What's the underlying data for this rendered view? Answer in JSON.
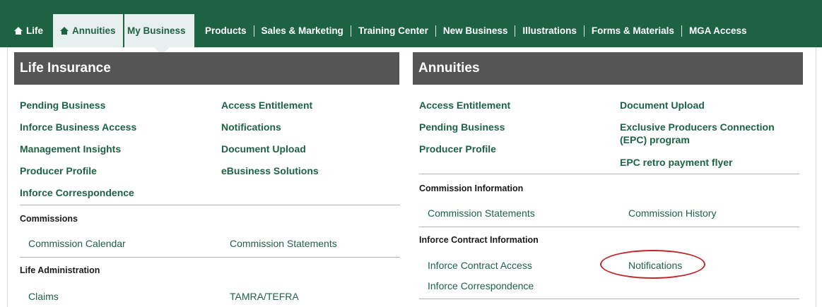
{
  "topnav": {
    "tabs": [
      {
        "label": "Life",
        "icon": "home-icon"
      },
      {
        "label": "Annuities",
        "icon": "home-icon"
      },
      {
        "label": "My Business"
      }
    ],
    "links": [
      "Products",
      "Sales & Marketing",
      "Training Center",
      "New Business",
      "Illustrations",
      "Forms & Materials",
      "MGA Access"
    ]
  },
  "life": {
    "title": "Life Insurance",
    "primary_left": [
      "Pending Business",
      "Inforce Business Access",
      "Management Insights",
      "Producer Profile",
      "Inforce Correspondence"
    ],
    "primary_right": [
      "Access Entitlement",
      "Notifications",
      "Document Upload",
      "eBusiness Solutions"
    ],
    "commissions": {
      "title": "Commissions",
      "links": [
        "Commission Calendar",
        "Commission Statements"
      ]
    },
    "administration": {
      "title": "Life Administration",
      "links": [
        "Claims",
        "TAMRA/TEFRA"
      ]
    }
  },
  "annuities": {
    "title": "Annuities",
    "primary_left": [
      "Access Entitlement",
      "Pending Business",
      "Producer Profile"
    ],
    "primary_right": [
      "Document Upload",
      "Exclusive Producers Connection (EPC) program",
      "EPC retro payment flyer"
    ],
    "commission_info": {
      "title": "Commission Information",
      "links": [
        "Commission Statements",
        "Commission History"
      ]
    },
    "inforce_info": {
      "title": "Inforce Contract Information",
      "links": [
        "Inforce Contract Access",
        "Notifications",
        "Inforce Correspondence"
      ]
    }
  },
  "colors": {
    "brand_green": "#1e6244",
    "header_gray": "#555555",
    "active_tab": "#e7f0ee",
    "highlight_red": "#c0272d"
  }
}
